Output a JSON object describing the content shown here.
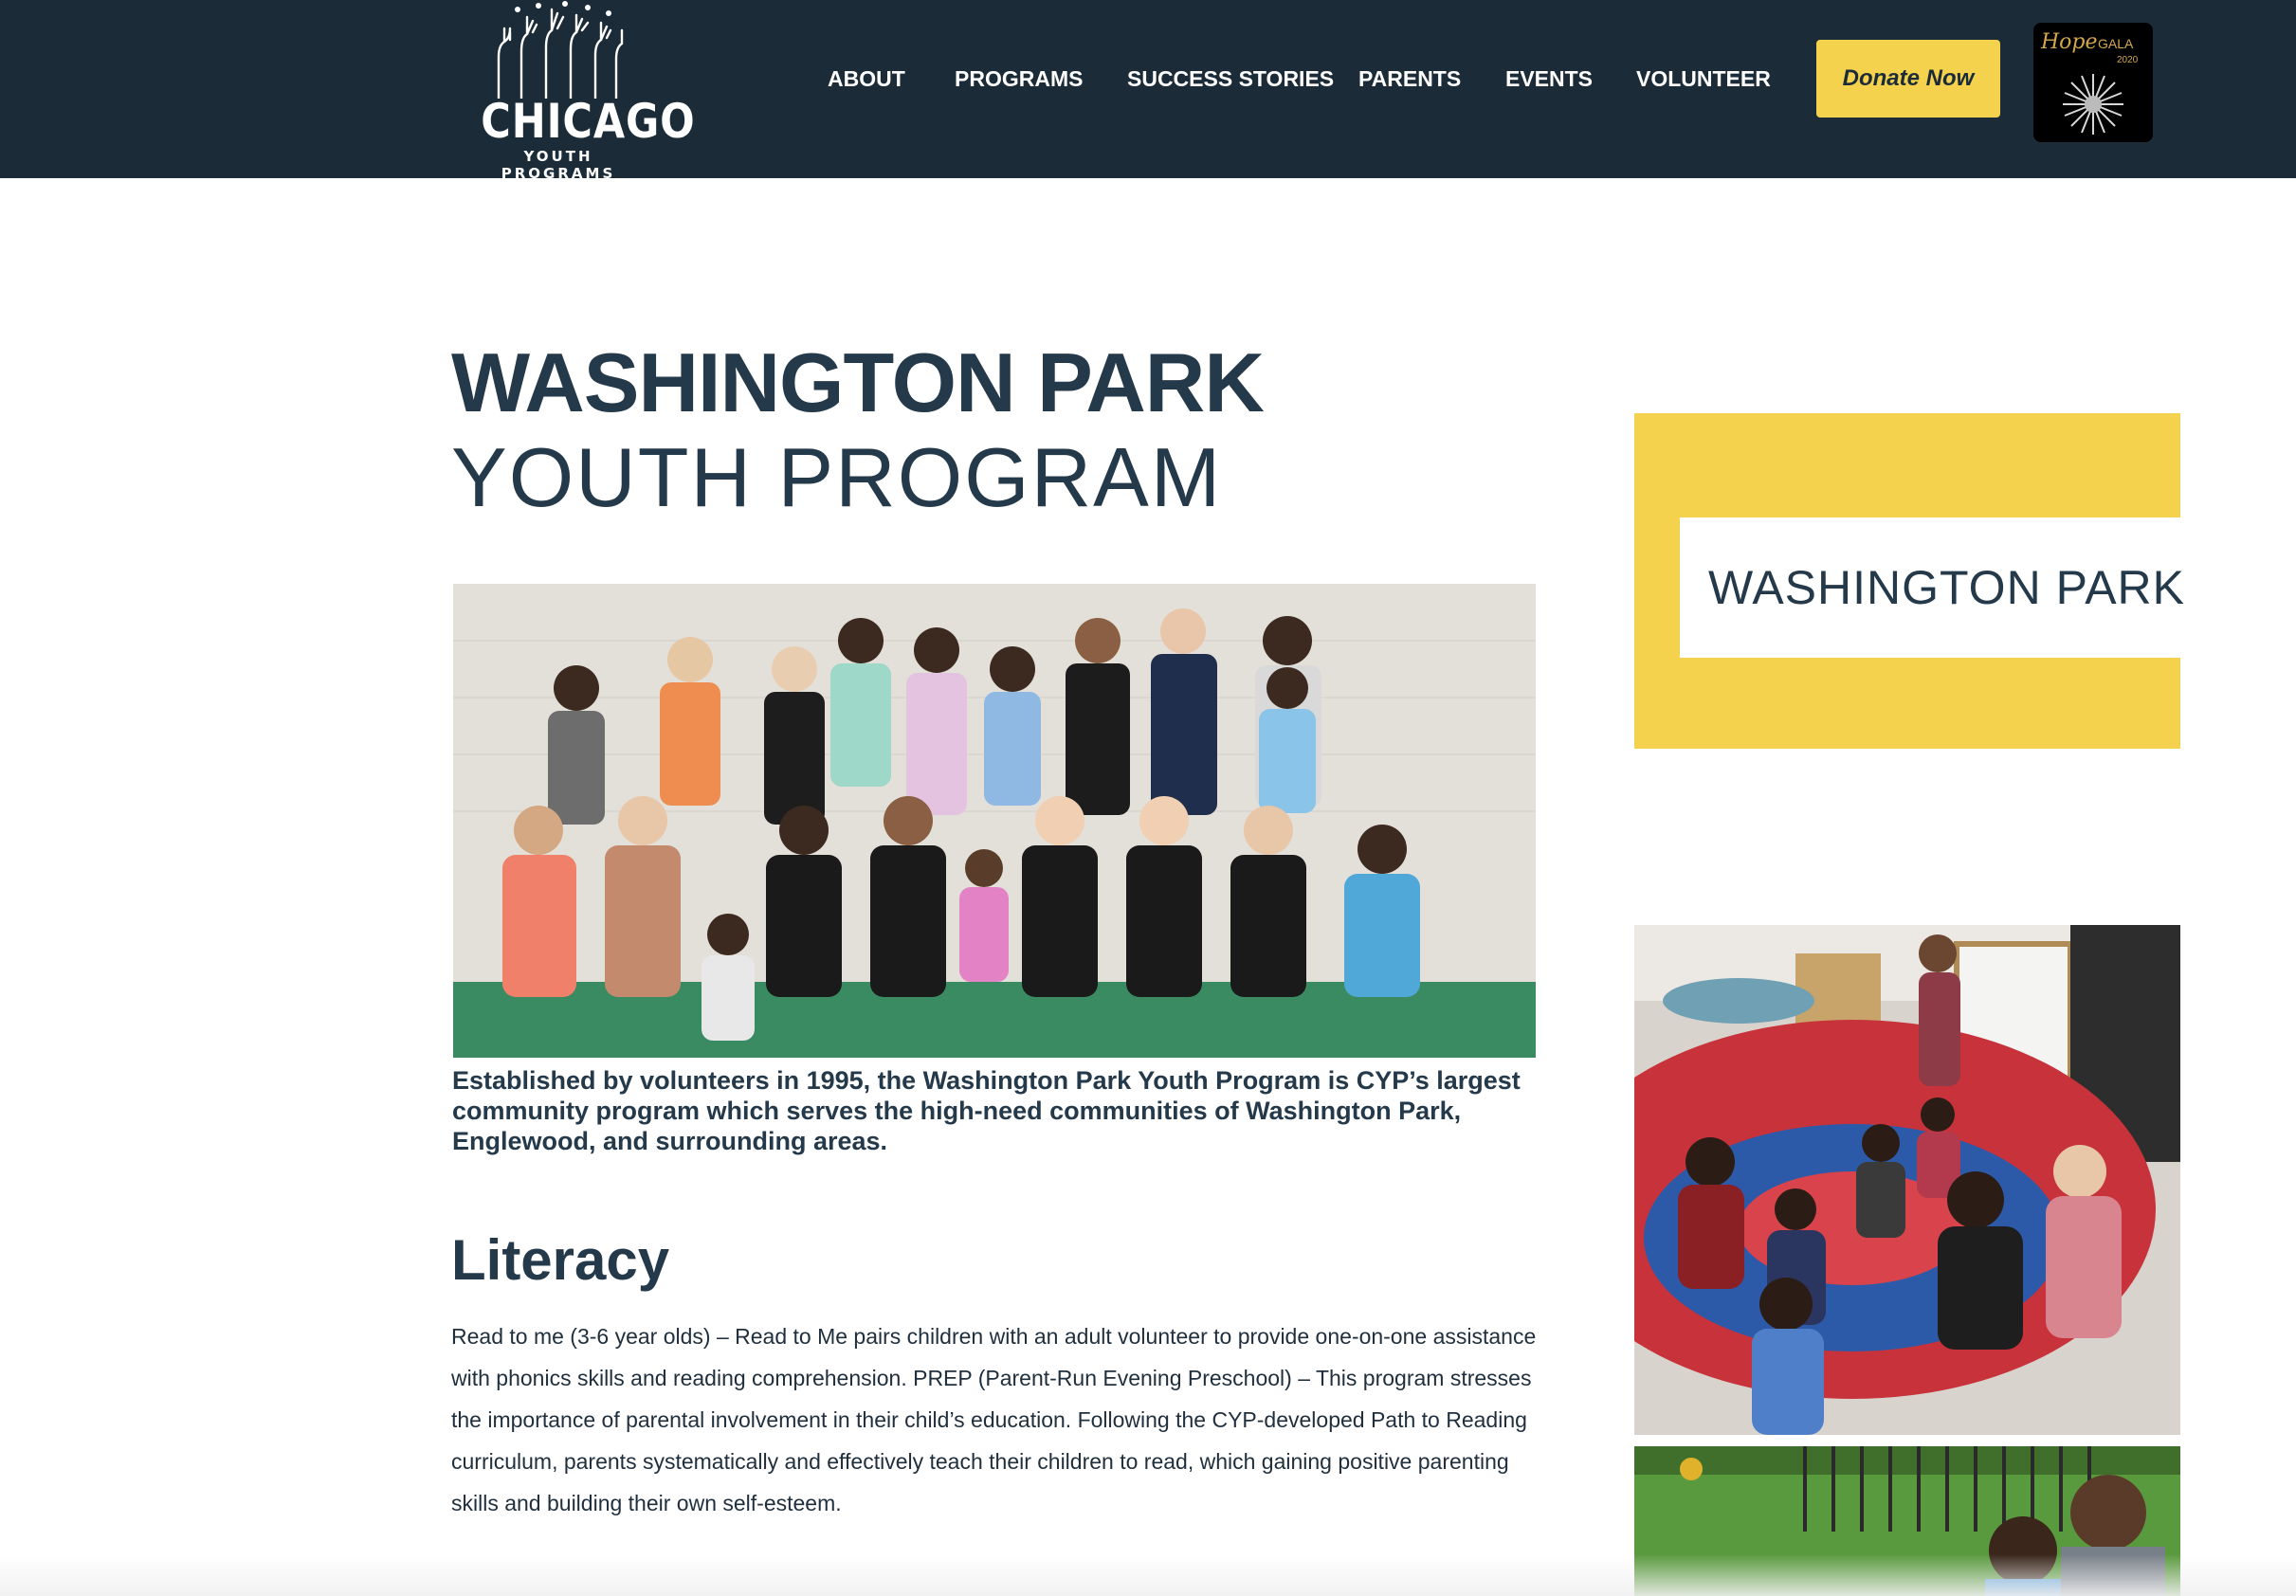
{
  "header": {
    "logo": {
      "title": "CHICAGO",
      "subtitle": "YOUTH PROGRAMS"
    },
    "nav": [
      {
        "label": "ABOUT"
      },
      {
        "label": "PROGRAMS"
      },
      {
        "label": "SUCCESS STORIES"
      },
      {
        "label": "PARENTS"
      },
      {
        "label": "EVENTS"
      },
      {
        "label": "VOLUNTEER"
      }
    ],
    "donate_label": "Donate Now",
    "gala": {
      "hope": "Hope",
      "gala": "GALA",
      "year": "2020"
    }
  },
  "main": {
    "title_bold": "WASHINGTON PARK",
    "title_light": "YOUTH PROGRAM",
    "intro": "Established by volunteers in 1995, the Washington Park Youth Program is CYP’s largest community program which serves the high-need communities of Washington Park, Englewood, and surrounding areas.",
    "section": {
      "heading": "Literacy",
      "body": "Read to me (3-6 year olds) – Read to Me pairs children with an adult volunteer to provide one-on-one assistance with phonics skills and reading comprehension. PREP (Parent-Run Evening Preschool) – This program stresses the importance of parental involvement in their child’s education. Following the CYP-developed Path to Reading curriculum, parents systematically and effectively teach their children to read, which gaining positive parenting skills and building their own self-esteem."
    }
  },
  "sidebar": {
    "label": "WASHINGTON PARK"
  },
  "colors": {
    "header_bg": "#1b2b38",
    "accent_yellow": "#f5d24d",
    "heading_text": "#24394a"
  }
}
